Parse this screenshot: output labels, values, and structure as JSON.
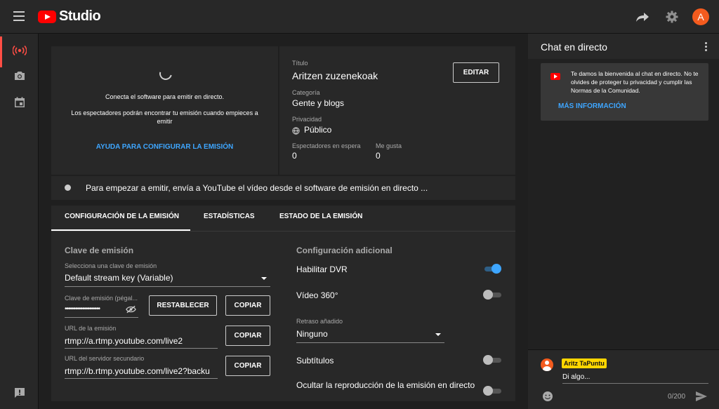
{
  "app": {
    "logo_text": "Studio",
    "avatar_initial": "A"
  },
  "preview": {
    "message_1": "Conecta el software para emitir en directo.",
    "message_2": "Los espectadores podrán encontrar tu emisión cuando empieces a emitir",
    "help_link": "AYUDA PARA CONFIGURAR LA EMISIÓN"
  },
  "info": {
    "title_label": "Título",
    "title_value": "Aritzen zuzenekoak",
    "edit_button": "EDITAR",
    "category_label": "Categoría",
    "category_value": "Gente y blogs",
    "privacy_label": "Privacidad",
    "privacy_value": "Público",
    "waiting_label": "Espectadores en espera",
    "waiting_value": "0",
    "likes_label": "Me gusta",
    "likes_value": "0"
  },
  "status": {
    "text": "Para empezar a emitir, envía a YouTube el vídeo desde el software de emisión en directo ..."
  },
  "tabs": [
    {
      "label": "CONFIGURACIÓN DE LA EMISIÓN",
      "active": true
    },
    {
      "label": "ESTADÍSTICAS",
      "active": false
    },
    {
      "label": "ESTADO DE LA EMISIÓN",
      "active": false
    }
  ],
  "stream_key": {
    "section_title": "Clave de emisión",
    "select_label": "Selecciona una clave de emisión",
    "select_value": "Default stream key (Variable)",
    "key_label": "Clave de emisión (pégal...",
    "key_value": "••••••••••••••••••••",
    "reset_button": "RESTABLECER",
    "copy_button": "COPIAR",
    "url_label": "URL de la emisión",
    "url_value": "rtmp://a.rtmp.youtube.com/live2",
    "backup_label": "URL del servidor secundario",
    "backup_value": "rtmp://b.rtmp.youtube.com/live2?backu"
  },
  "additional": {
    "section_title": "Configuración adicional",
    "dvr_label": "Habilitar DVR",
    "dvr_on": true,
    "v360_label": "Vídeo 360°",
    "v360_on": false,
    "delay_label": "Retraso añadido",
    "delay_value": "Ninguno",
    "subtitles_label": "Subtítulos",
    "subtitles_on": false,
    "hide_label": "Ocultar la reproducción de la emisión en directo"
  },
  "chat": {
    "title": "Chat en directo",
    "welcome_text": "Te damos la bienvenida al chat en directo. No te olvides de proteger tu privacidad y cumplir las Normas de la Comunidad.",
    "more_info": "MÁS INFORMACIÓN",
    "user_name": "Aritz TaPuntu",
    "input_placeholder": "Di algo...",
    "counter": "0/200"
  },
  "colors": {
    "accent": "#3ea6ff",
    "brand": "#ff0000",
    "live": "#ff4e45"
  }
}
